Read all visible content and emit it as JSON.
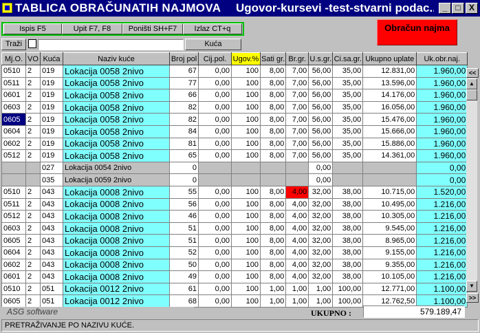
{
  "window": {
    "title_left": "TABLICA OBRAČUNATIH NAJMOVA",
    "title_right": "Ugovor-kursevi -test-stvarni podac...",
    "minimize": "_",
    "maximize": "□",
    "close": "X"
  },
  "toolbar": {
    "search_btn": "Ispis F5",
    "upit_btn": "Upit F7, F8",
    "ponisti_btn": "Poništi SH+F7",
    "izlaz_btn": "Izlaz CT+q",
    "calc_btn": "Obračun najma",
    "trazi_btn": "Traži",
    "kuca_btn": "Kuća",
    "search_value": ""
  },
  "table": {
    "headers": [
      "Mj.O.",
      "VO",
      "Kuća",
      "Naziv kuće",
      "Broj pol",
      "Cij.pol.",
      "Ugov.%",
      "Sati gr.",
      "Br.gr.",
      "U.s.gr.",
      "Ci.sa.gr.",
      "Ukupno uplate",
      "Uk.obr.naj."
    ],
    "rows": [
      [
        "0510",
        "2",
        "019",
        "Lokacija 0058 2nivo",
        "67",
        "0,00",
        "100",
        "8,00",
        "7,00",
        "56,00",
        "35,00",
        "12.831,00",
        "1.960,00"
      ],
      [
        "0511",
        "2",
        "019",
        "Lokacija 0058 2nivo",
        "77",
        "0,00",
        "100",
        "8,00",
        "7,00",
        "56,00",
        "35,00",
        "13.596,00",
        "1.960,00"
      ],
      [
        "0601",
        "2",
        "019",
        "Lokacija 0058 2nivo",
        "66",
        "0,00",
        "100",
        "8,00",
        "7,00",
        "56,00",
        "35,00",
        "14.176,00",
        "1.960,00"
      ],
      [
        "0603",
        "2",
        "019",
        "Lokacija 0058 2nivo",
        "82",
        "0,00",
        "100",
        "8,00",
        "7,00",
        "56,00",
        "35,00",
        "16.056,00",
        "1.960,00"
      ],
      [
        "0605",
        "2",
        "019",
        "Lokacija 0058 2nivo",
        "82",
        "0,00",
        "100",
        "8,00",
        "7,00",
        "56,00",
        "35,00",
        "15.476,00",
        "1.960,00"
      ],
      [
        "0604",
        "2",
        "019",
        "Lokacija 0058 2nivo",
        "84",
        "0,00",
        "100",
        "8,00",
        "7,00",
        "56,00",
        "35,00",
        "15.666,00",
        "1.960,00"
      ],
      [
        "0602",
        "2",
        "019",
        "Lokacija 0058 2nivo",
        "81",
        "0,00",
        "100",
        "8,00",
        "7,00",
        "56,00",
        "35,00",
        "15.886,00",
        "1.960,00"
      ],
      [
        "0512",
        "2",
        "019",
        "Lokacija 0058 2nivo",
        "65",
        "0,00",
        "100",
        "8,00",
        "7,00",
        "56,00",
        "35,00",
        "14.361,00",
        "1.960,00"
      ],
      [
        "",
        "",
        "027",
        "Lokacija 0054 2nivo",
        "0",
        "",
        "",
        "",
        "",
        "0,00",
        "",
        "",
        "0,00"
      ],
      [
        "",
        "",
        "035",
        "Lokacija 0059 2nivo",
        "0",
        "",
        "",
        "",
        "",
        "0,00",
        "",
        "",
        "0,00"
      ],
      [
        "0510",
        "2",
        "043",
        "Lokacija 0008 2nivo",
        "55",
        "0,00",
        "100",
        "8,00",
        "4,00",
        "32,00",
        "38,00",
        "10.715,00",
        "1.520,00"
      ],
      [
        "0511",
        "2",
        "043",
        "Lokacija 0008 2nivo",
        "56",
        "0,00",
        "100",
        "8,00",
        "4,00",
        "32,00",
        "38,00",
        "10.495,00",
        "1.216,00"
      ],
      [
        "0512",
        "2",
        "043",
        "Lokacija 0008 2nivo",
        "46",
        "0,00",
        "100",
        "8,00",
        "4,00",
        "32,00",
        "38,00",
        "10.305,00",
        "1.216,00"
      ],
      [
        "0603",
        "2",
        "043",
        "Lokacija 0008 2nivo",
        "51",
        "0,00",
        "100",
        "8,00",
        "4,00",
        "32,00",
        "38,00",
        "9.545,00",
        "1.216,00"
      ],
      [
        "0605",
        "2",
        "043",
        "Lokacija 0008 2nivo",
        "51",
        "0,00",
        "100",
        "8,00",
        "4,00",
        "32,00",
        "38,00",
        "8.965,00",
        "1.216,00"
      ],
      [
        "0604",
        "2",
        "043",
        "Lokacija 0008 2nivo",
        "52",
        "0,00",
        "100",
        "8,00",
        "4,00",
        "32,00",
        "38,00",
        "9.155,00",
        "1.216,00"
      ],
      [
        "0602",
        "2",
        "043",
        "Lokacija 0008 2nivo",
        "50",
        "0,00",
        "100",
        "8,00",
        "4,00",
        "32,00",
        "38,00",
        "9.355,00",
        "1.216,00"
      ],
      [
        "0601",
        "2",
        "043",
        "Lokacija 0008 2nivo",
        "49",
        "0,00",
        "100",
        "8,00",
        "4,00",
        "32,00",
        "38,00",
        "10.105,00",
        "1.216,00"
      ],
      [
        "0510",
        "2",
        "051",
        "Lokacija 0012 2nivo",
        "61",
        "0,00",
        "100",
        "1,00",
        "1,00",
        "1,00",
        "100,00",
        "12.771,00",
        "1.100,00"
      ],
      [
        "0605",
        "2",
        "051",
        "Lokacija 0012 2nivo",
        "68",
        "0,00",
        "100",
        "1,00",
        "1,00",
        "1,00",
        "100,00",
        "12.762,50",
        "1.100,00"
      ]
    ],
    "selected_row": 4,
    "red_cell": [
      10,
      8
    ]
  },
  "footer": {
    "software": "ASG software",
    "sum_label": "UKUPNO :",
    "sum_value": "579.189,47",
    "status": "PRETRAŽIVANJE PO NAZIVU KUĆE."
  },
  "nav": {
    "prev": "<<",
    "next": ">>"
  },
  "colors": {
    "title_bg": "#000080",
    "cyan": "#80ffff",
    "red": "#ff0000",
    "highlight": "#ffff00"
  }
}
